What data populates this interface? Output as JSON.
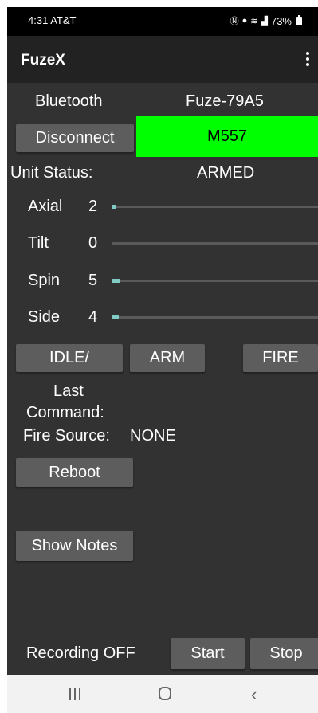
{
  "status_bar": {
    "time_carrier": "4:31 AT&T",
    "icons": [
      "nfc-icon",
      "location-icon",
      "wifi-icon",
      "signal-icon"
    ],
    "battery": "73%"
  },
  "app_bar": {
    "title": "FuzeX",
    "menu_icon": "overflow-menu-icon"
  },
  "bluetooth": {
    "label": "Bluetooth",
    "device_name": "Fuze-79A5",
    "disconnect_label": "Disconnect",
    "selected_device": "M557",
    "selected_device_color": "#00ff00"
  },
  "unit_status": {
    "label": "Unit Status:",
    "value": "ARMED"
  },
  "sensors": [
    {
      "name": "Axial",
      "value": "2",
      "level": 0.01
    },
    {
      "name": "Tilt",
      "value": "0",
      "level": 0.0
    },
    {
      "name": "Spin",
      "value": "5",
      "level": 0.04
    },
    {
      "name": "Side",
      "value": "4",
      "level": 0.03
    }
  ],
  "commands": {
    "idle": "IDLE/",
    "arm": "ARM",
    "fire": "FIRE"
  },
  "last_command": {
    "line1": "Last",
    "line2": "Command:"
  },
  "fire_source": {
    "label": "Fire Source:",
    "value": "NONE"
  },
  "reboot_label": "Reboot",
  "show_notes_label": "Show Notes",
  "recording": {
    "status": "Recording OFF",
    "start_label": "Start",
    "stop_label": "Stop"
  },
  "nav_bar": {
    "recents_icon": "recents-icon",
    "home_icon": "home-icon",
    "back_icon": "back-icon"
  }
}
